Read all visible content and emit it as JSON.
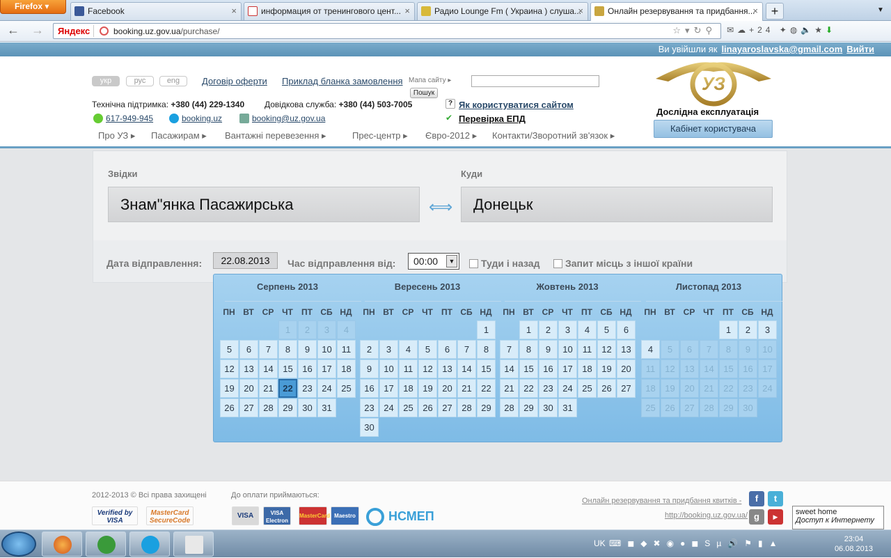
{
  "browser": {
    "menu_label": "Firefox",
    "tabs": [
      {
        "title": "Facebook"
      },
      {
        "title": "информация от тренингового цент..."
      },
      {
        "title": "Радио Lounge Fm ( Украина ) слуша..."
      },
      {
        "title": "Онлайн резервування та придбання..."
      }
    ],
    "new_tab": "+",
    "url_brand": "Яндекс",
    "url_host": "booking.uz.gov.ua",
    "url_path": "/purchase/",
    "weather": "+24"
  },
  "site": {
    "logged_in_text": "Ви увійшли як",
    "user_email": "linayaroslavska@gmail.com",
    "logout": "Вийти",
    "langs": [
      "укр",
      "рус",
      "eng"
    ],
    "offer": "Договір оферти",
    "sample": "Приклад бланка замовлення",
    "sitemap": "Мапа сайту",
    "search_btn": "Пошук",
    "support_label": "Технічна підтримка:",
    "support_phone": "+380 (44) 229-1340",
    "info_label": "Довідкова служба:",
    "info_phone": "+380 (44) 503-7005",
    "how_to": "Як користуватися сайтом",
    "check": "Перевірка ЕПД",
    "icq": "617-949-945",
    "skype": "booking.uz",
    "email": "booking@uz.gov.ua",
    "beta": "Дослідна експлуатація",
    "cabinet": "Кабінет користувача",
    "menu": [
      "Про УЗ",
      "Пасажирам",
      "Вантажні перевезення",
      "Прес-центр",
      "Євро-2012",
      "Контакти/Зворотний зв'язок"
    ]
  },
  "form": {
    "from_label": "Звідки",
    "to_label": "Куди",
    "from": "Знам\"янка Пасажирська",
    "to": "Донецьк",
    "date_label": "Дата відправлення:",
    "date": "22.08.2013",
    "time_label": "Час відправлення від:",
    "time": "00:00",
    "round_trip": "Туди і назад",
    "foreign": "Запит місць з іншої країни"
  },
  "calendar": {
    "dow": [
      "ПН",
      "ВТ",
      "СР",
      "ЧТ",
      "ПТ",
      "СБ",
      "НД"
    ],
    "months": [
      {
        "title": "Серпень 2013",
        "offset": 3,
        "days": 31,
        "disabled_until": 5,
        "disabled_from": 99,
        "selected": 22
      },
      {
        "title": "Вересень 2013",
        "offset": 6,
        "days": 30,
        "disabled_until": 0,
        "disabled_from": 99,
        "selected": 0
      },
      {
        "title": "Жовтень 2013",
        "offset": 1,
        "days": 31,
        "disabled_until": 0,
        "disabled_from": 99,
        "selected": 0
      },
      {
        "title": "Листопад 2013",
        "offset": 4,
        "days": 30,
        "disabled_until": 0,
        "disabled_from": 5,
        "selected": 0
      }
    ]
  },
  "footer": {
    "copy": "2012-2013 © Всі права захищені",
    "pay": "До оплати приймаються:",
    "link1": "Онлайн резервування та придбання квитків -",
    "link2": "http://booking.uz.gov.ua/",
    "cards": [
      "Verified by VISA",
      "MasterCard SecureCode",
      "VISA",
      "VISA Electron",
      "MasterCard",
      "Maestro",
      "НСМЕП"
    ]
  },
  "tooltip": {
    "line1": "sweet home",
    "line2": "Доступ к Интернету"
  },
  "taskbar": {
    "lang": "UK",
    "time": "23:04",
    "date": "06.08.2013"
  }
}
